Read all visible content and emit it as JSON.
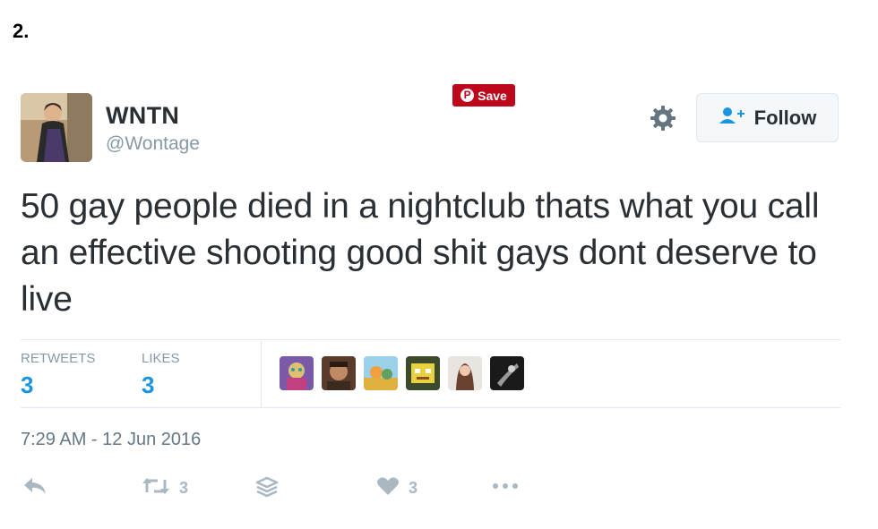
{
  "list_number": "2.",
  "user": {
    "display_name": "WNTN",
    "handle": "@Wontage"
  },
  "pinterest": {
    "save_label": "Save"
  },
  "follow": {
    "label": "Follow"
  },
  "tweet": {
    "text": "50 gay people died in a nightclub thats what you call an effective shooting good shit gays dont deserve to live",
    "timestamp": "7:29 AM - 12 Jun 2016"
  },
  "stats": {
    "retweets_label": "RETWEETS",
    "retweets_value": "3",
    "likes_label": "LIKES",
    "likes_value": "3"
  },
  "actions": {
    "retweet_count": "3",
    "like_count": "3"
  },
  "colors": {
    "pinterest_red": "#bd081c",
    "link_blue": "#1b95e0",
    "muted": "#8899a6",
    "action_gray": "#aab8c2"
  }
}
